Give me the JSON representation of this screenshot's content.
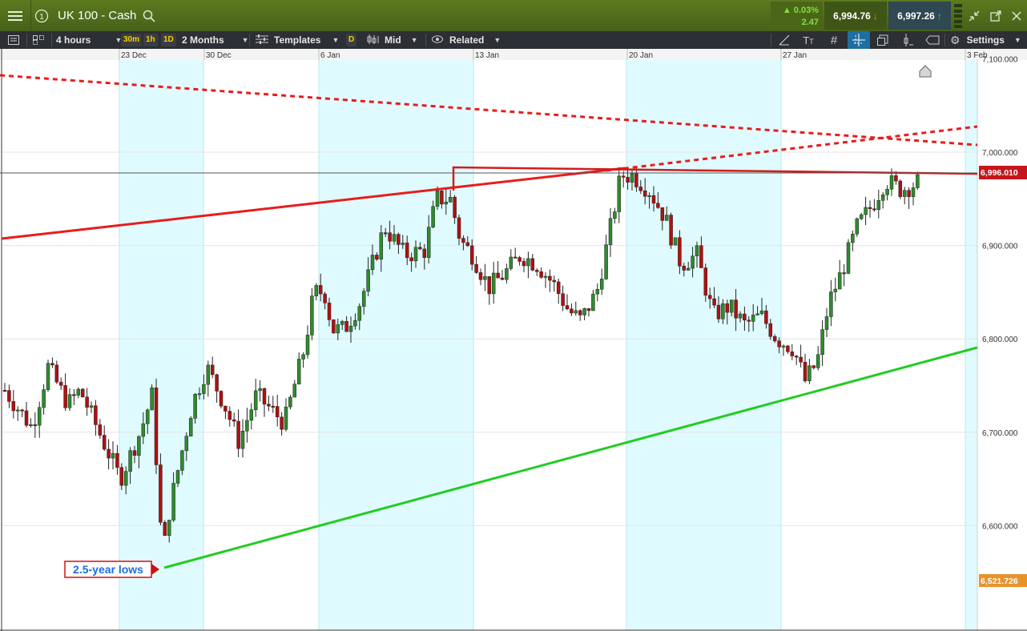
{
  "header": {
    "menu_icon": "hamburger-menu-icon",
    "info_icon": "info-circle-icon",
    "instrument": "UK 100 - Cash",
    "search_icon": "search-icon",
    "change_percent": "▲ 0.03%",
    "change_points": "2.47",
    "sell_price": "6,994.76",
    "buy_price": "6,997.26",
    "colors": {
      "bar": "#587520",
      "sell_box": "#3f5517",
      "buy_box": "#2f4852",
      "up": "#7ee03a"
    }
  },
  "toolbar": {
    "timeframe": "4 hours",
    "quick_30m": "30m",
    "quick_1h": "1h",
    "quick_1d": "1D",
    "range": "2 Months",
    "templates": "Templates",
    "d_badge": "D",
    "price_type": "Mid",
    "related": "Related",
    "settings": "Settings",
    "icons": [
      "list-icon",
      "layout-icon",
      "draw-line-icon",
      "text-icon",
      "grid-icon",
      "crosshair-icon",
      "copy-icon",
      "indicator-icon",
      "label-icon",
      "gear-icon"
    ]
  },
  "chart_data": {
    "type": "candlestick",
    "x_tick_labels": [
      "23 Dec",
      "30 Dec",
      "6 Jan",
      "13 Jan",
      "20 Jan",
      "27 Jan",
      "3 Feb"
    ],
    "y_tick_labels": [
      "7,100.000",
      "7,000.000",
      "6,900.000",
      "6,800.000",
      "6,700.000",
      "6,600.000"
    ],
    "ylim": [
      6470,
      7110
    ],
    "current_price_label": "6,996.010",
    "current_price": 6996.01,
    "low_marker_label": "6,521.726",
    "low_marker": 6521.726,
    "annotation": "2.5-year lows",
    "colors": {
      "up": "#2e8b2e",
      "down": "#b01010",
      "support": "#22cc22",
      "resistance": "#e81c1c",
      "weekend_shade": "#e0fbff"
    }
  }
}
